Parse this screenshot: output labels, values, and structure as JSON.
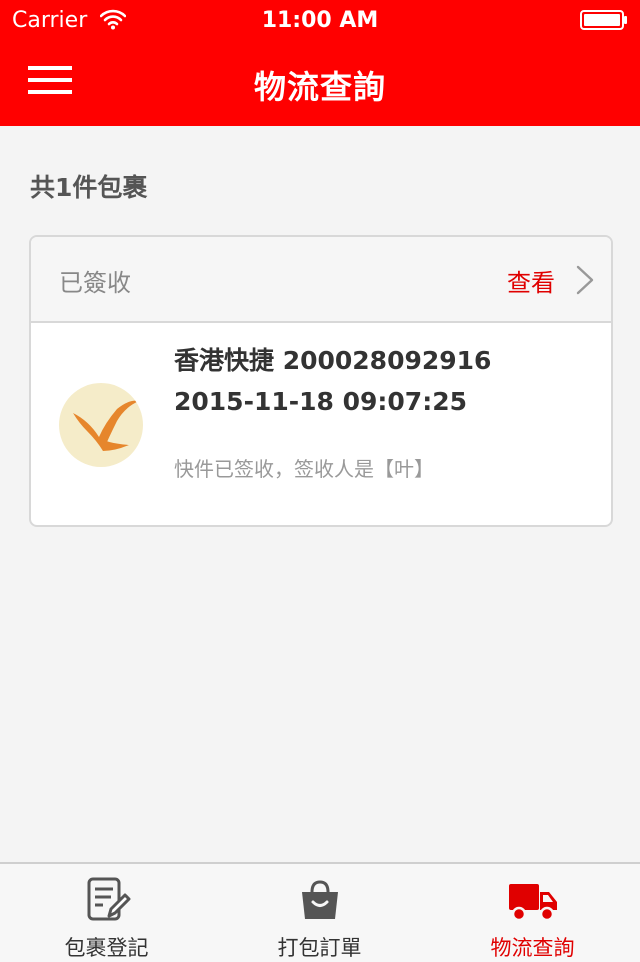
{
  "status_bar": {
    "carrier": "Carrier",
    "time": "11:00 AM"
  },
  "nav": {
    "title": "物流查詢",
    "menu_icon": "hamburger-menu-icon"
  },
  "summary": {
    "count_text": "共1件包裹"
  },
  "parcel": {
    "status": "已簽收",
    "view_label": "查看",
    "carrier_line": "香港快捷 200028092916",
    "datetime": "2015-11-18 09:07:25",
    "message": "快件已签收，签收人是【叶】"
  },
  "tabs": [
    {
      "label": "包裹登記",
      "icon": "edit-document-icon",
      "active": false
    },
    {
      "label": "打包訂單",
      "icon": "shopping-bag-icon",
      "active": false
    },
    {
      "label": "物流查詢",
      "icon": "delivery-truck-icon",
      "active": true
    }
  ],
  "colors": {
    "accent": "#ff0000",
    "active_tab": "#e00000"
  }
}
